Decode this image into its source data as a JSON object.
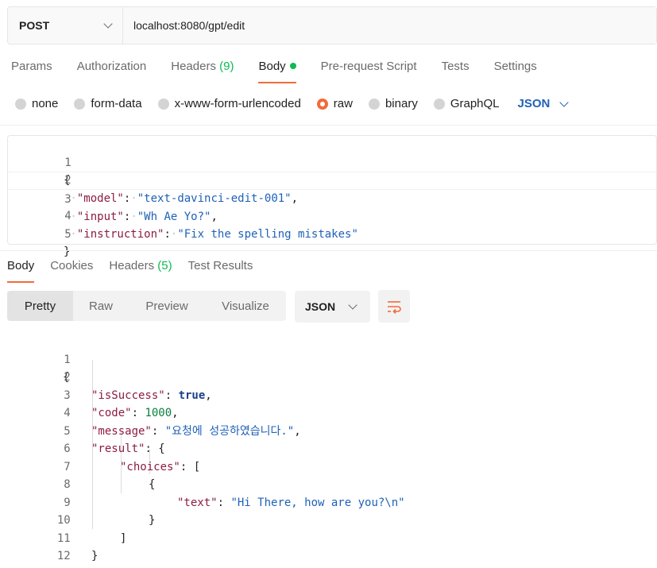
{
  "request": {
    "method": "POST",
    "url": "localhost:8080/gpt/edit",
    "tabs": [
      {
        "label": "Params"
      },
      {
        "label": "Authorization"
      },
      {
        "label": "Headers",
        "count": "(9)"
      },
      {
        "label": "Body"
      },
      {
        "label": "Pre-request Script"
      },
      {
        "label": "Tests"
      },
      {
        "label": "Settings"
      }
    ],
    "body_types": [
      "none",
      "form-data",
      "x-www-form-urlencoded",
      "raw",
      "binary",
      "GraphQL"
    ],
    "selected_body_type": "raw",
    "format": "JSON",
    "body_lines": [
      {
        "n": "1",
        "open": "{"
      },
      {
        "n": "2",
        "key": "\"model\"",
        "value": "\"text-davinci-edit-001\""
      },
      {
        "n": "3",
        "key": "\"input\"",
        "value": "\"Wh Ae Yo?\""
      },
      {
        "n": "4",
        "key": "\"instruction\"",
        "value": "\"Fix the spelling mistakes\""
      },
      {
        "n": "5",
        "close": "}"
      }
    ]
  },
  "response": {
    "tabs": [
      {
        "label": "Body"
      },
      {
        "label": "Cookies"
      },
      {
        "label": "Headers",
        "count": "(5)"
      },
      {
        "label": "Test Results"
      }
    ],
    "views": [
      "Pretty",
      "Raw",
      "Preview",
      "Visualize"
    ],
    "active_view": "Pretty",
    "format": "JSON",
    "line_numbers": [
      "1",
      "2",
      "3",
      "4",
      "5",
      "6",
      "7",
      "8",
      "9",
      "10",
      "11",
      "12"
    ],
    "lines": {
      "l1": "{",
      "isSuccess_key": "\"isSuccess\"",
      "isSuccess_val": "true",
      "code_key": "\"code\"",
      "code_val": "1000",
      "message_key": "\"message\"",
      "message_val": "\"요청에 성공하였습니다.\"",
      "result_key": "\"result\"",
      "result_open": "{",
      "choices_key": "\"choices\"",
      "choices_open": "[",
      "obj_open": "{",
      "text_key": "\"text\"",
      "text_val": "\"Hi There, how are you?\\n\"",
      "obj_close": "}",
      "choices_close": "]",
      "result_close": "}",
      "l12": "}"
    }
  },
  "colors": {
    "accent": "#f26b3a",
    "count_green": "#0cbb52",
    "json_blue": "#1f61b8",
    "key": "#8c1c43",
    "string": "#1f61b8",
    "number": "#0b7d3e"
  }
}
